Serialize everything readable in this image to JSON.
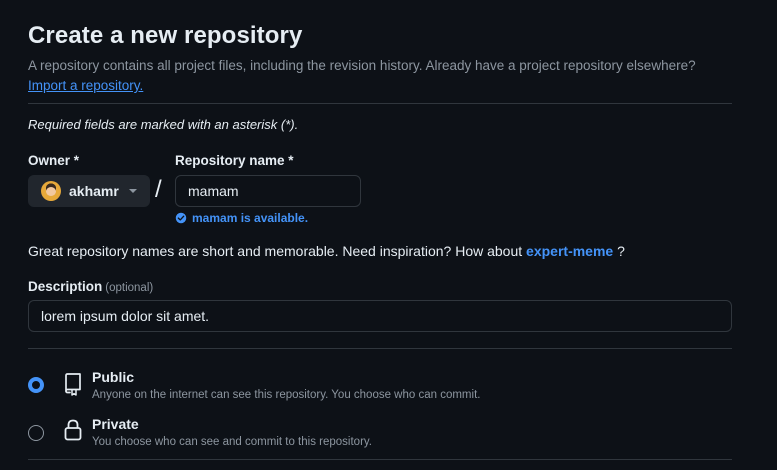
{
  "header": {
    "title": "Create a new repository",
    "subtitle": "A repository contains all project files, including the revision history. Already have a project repository elsewhere?",
    "import_link": "Import a repository."
  },
  "form": {
    "required_note": "Required fields are marked with an asterisk (*).",
    "owner": {
      "label": "Owner *",
      "value": "akhamr"
    },
    "separator": "/",
    "repo_name": {
      "label": "Repository name *",
      "value": "mamam",
      "availability": "mamam is available."
    },
    "inspiration": {
      "text": "Great repository names are short and memorable. Need inspiration? How about",
      "suggestion": "expert-meme",
      "suffix": "?"
    },
    "description": {
      "label": "Description",
      "optional": "(optional)",
      "value": "lorem ipsum dolor sit amet."
    },
    "visibility": [
      {
        "title": "Public",
        "description": "Anyone on the internet can see this repository. You choose who can commit.",
        "selected": true,
        "icon": "repo-icon"
      },
      {
        "title": "Private",
        "description": "You choose who can see and commit to this repository.",
        "selected": false,
        "icon": "lock-icon"
      }
    ]
  },
  "colors": {
    "background": "#0d1117",
    "text": "#e6edf3",
    "muted": "#8d96a0",
    "link": "#4493f8",
    "border": "#30363d"
  }
}
